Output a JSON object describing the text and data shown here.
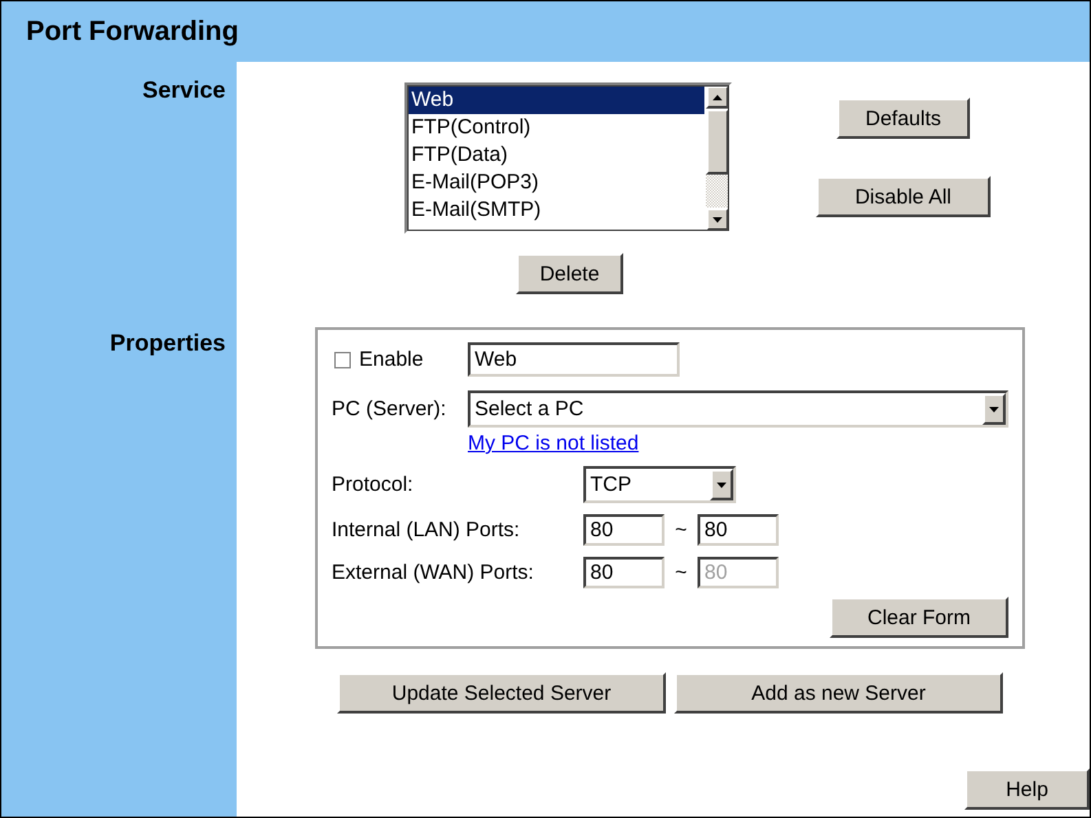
{
  "title": "Port Forwarding",
  "service": {
    "label": "Service",
    "items": [
      {
        "label": "Web",
        "selected": true
      },
      {
        "label": "FTP(Control)",
        "selected": false
      },
      {
        "label": "FTP(Data)",
        "selected": false
      },
      {
        "label": "E-Mail(POP3)",
        "selected": false
      },
      {
        "label": "E-Mail(SMTP)",
        "selected": false
      }
    ],
    "buttons": [
      "Defaults",
      "Disable All"
    ],
    "delete": "Delete"
  },
  "properties": {
    "label": "Properties",
    "enable": {
      "label": "Enable",
      "checked": false
    },
    "name": {
      "value": "Web"
    },
    "pc": {
      "label": "PC (Server):",
      "value": "Select a PC"
    },
    "link": "My PC is not listed",
    "protocol": {
      "label": "Protocol:",
      "value": "TCP"
    },
    "ports": [
      {
        "label": "Internal (LAN) Ports:",
        "sep": "~",
        "from": "80",
        "to": "80",
        "to_disabled": false
      },
      {
        "label": "External (WAN) Ports:",
        "sep": "~",
        "from": "80",
        "to": "80",
        "to_disabled": true
      }
    ],
    "clear": "Clear Form"
  },
  "actions": [
    "Update Selected Server",
    "Add as new Server"
  ],
  "help": "Help"
}
